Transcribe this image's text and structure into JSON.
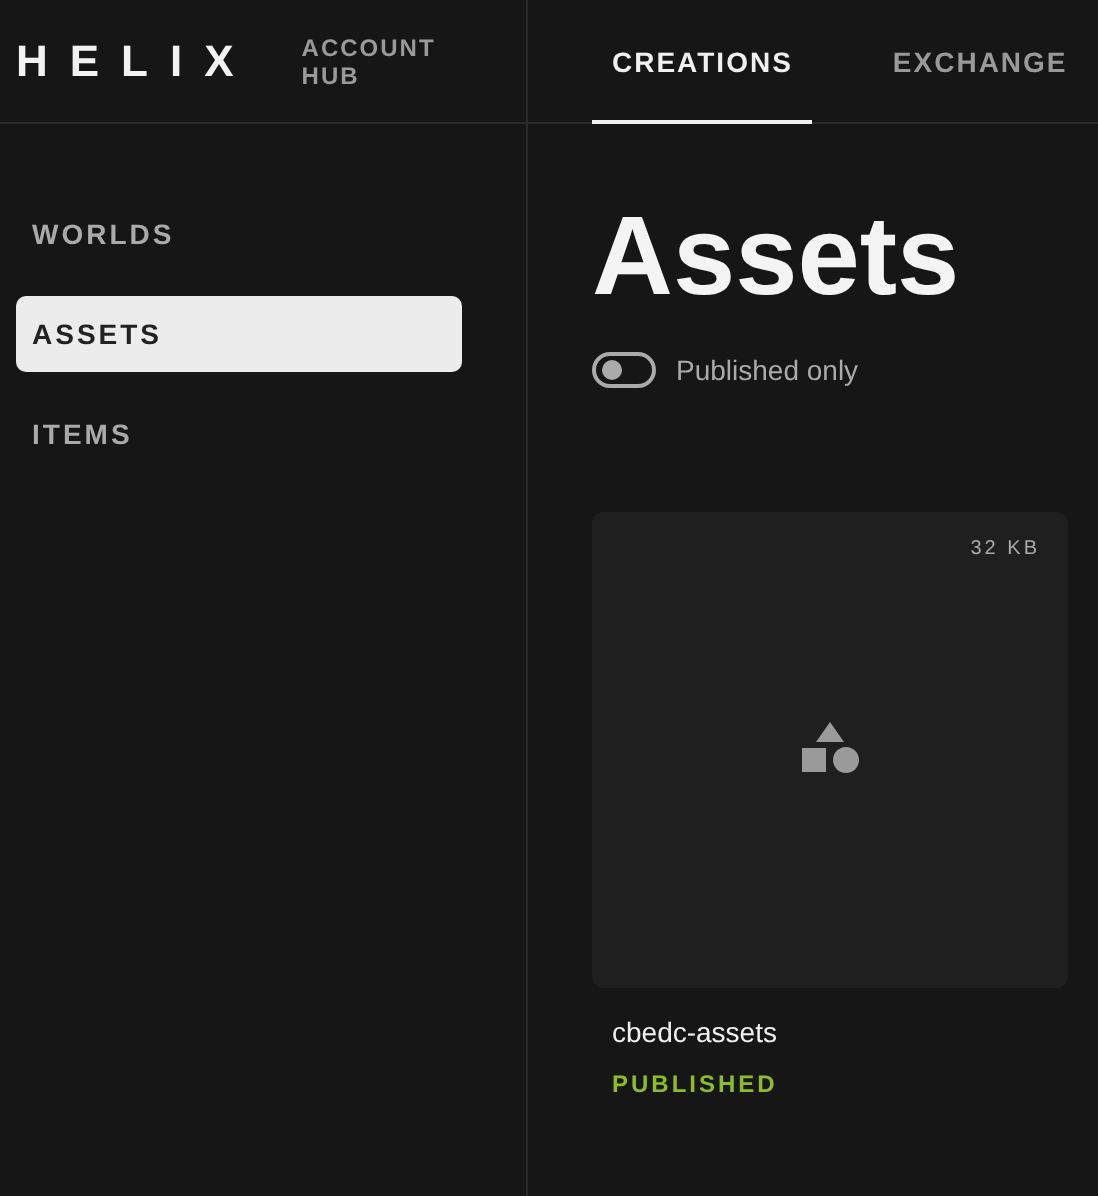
{
  "header": {
    "logo": "HELIX",
    "subtitle": "ACCOUNT HUB",
    "tabs": [
      {
        "label": "CREATIONS",
        "selected": true
      },
      {
        "label": "EXCHANGE",
        "selected": false
      }
    ]
  },
  "sidebar": {
    "items": [
      {
        "label": "WORLDS",
        "selected": false
      },
      {
        "label": "ASSETS",
        "selected": true
      },
      {
        "label": "ITEMS",
        "selected": false
      }
    ]
  },
  "page": {
    "title": "Assets",
    "filter": {
      "label": "Published only",
      "on": false
    },
    "cards": [
      {
        "size": "32 KB",
        "name": "cbedc-assets",
        "status": "PUBLISHED",
        "published": true
      }
    ]
  }
}
